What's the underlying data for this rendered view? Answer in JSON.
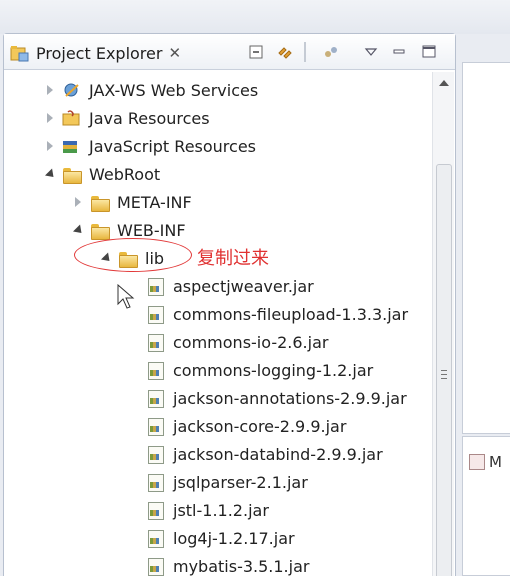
{
  "panel": {
    "title": "Project Explorer",
    "close_glyph": "✕",
    "toolbar": [
      "collapse-all-icon",
      "link-with-editor-icon",
      "filters-icon",
      "view-menu-icon",
      "minimize-icon",
      "maximize-icon"
    ]
  },
  "tree": {
    "items": [
      {
        "label": "JAX-WS Web Services",
        "icon": "web-services-icon",
        "state": "collapsed",
        "level": 0
      },
      {
        "label": "Java Resources",
        "icon": "java-resources-icon",
        "state": "collapsed",
        "level": 0
      },
      {
        "label": "JavaScript Resources",
        "icon": "javascript-resources-icon",
        "state": "collapsed",
        "level": 0
      },
      {
        "label": "WebRoot",
        "icon": "folder-icon",
        "state": "expanded",
        "level": 0
      },
      {
        "label": "META-INF",
        "icon": "folder-icon",
        "state": "collapsed",
        "level": 1
      },
      {
        "label": "WEB-INF",
        "icon": "folder-icon",
        "state": "expanded",
        "level": 1
      },
      {
        "label": "lib",
        "icon": "folder-icon",
        "state": "expanded",
        "level": 2
      },
      {
        "label": "aspectjweaver.jar",
        "icon": "jar-icon",
        "state": "leaf",
        "level": 3
      },
      {
        "label": "commons-fileupload-1.3.3.jar",
        "icon": "jar-icon",
        "state": "leaf",
        "level": 3
      },
      {
        "label": "commons-io-2.6.jar",
        "icon": "jar-icon",
        "state": "leaf",
        "level": 3
      },
      {
        "label": "commons-logging-1.2.jar",
        "icon": "jar-icon",
        "state": "leaf",
        "level": 3
      },
      {
        "label": "jackson-annotations-2.9.9.jar",
        "icon": "jar-icon",
        "state": "leaf",
        "level": 3
      },
      {
        "label": "jackson-core-2.9.9.jar",
        "icon": "jar-icon",
        "state": "leaf",
        "level": 3
      },
      {
        "label": "jackson-databind-2.9.9.jar",
        "icon": "jar-icon",
        "state": "leaf",
        "level": 3
      },
      {
        "label": "jsqlparser-2.1.jar",
        "icon": "jar-icon",
        "state": "leaf",
        "level": 3
      },
      {
        "label": "jstl-1.1.2.jar",
        "icon": "jar-icon",
        "state": "leaf",
        "level": 3
      },
      {
        "label": "log4j-1.2.17.jar",
        "icon": "jar-icon",
        "state": "leaf",
        "level": 3
      },
      {
        "label": "mybatis-3.5.1.jar",
        "icon": "jar-icon",
        "state": "leaf",
        "level": 3
      }
    ]
  },
  "annotation": {
    "text": "复制过来",
    "color": "#e03030"
  },
  "right_pane": {
    "tab_label": "M"
  }
}
